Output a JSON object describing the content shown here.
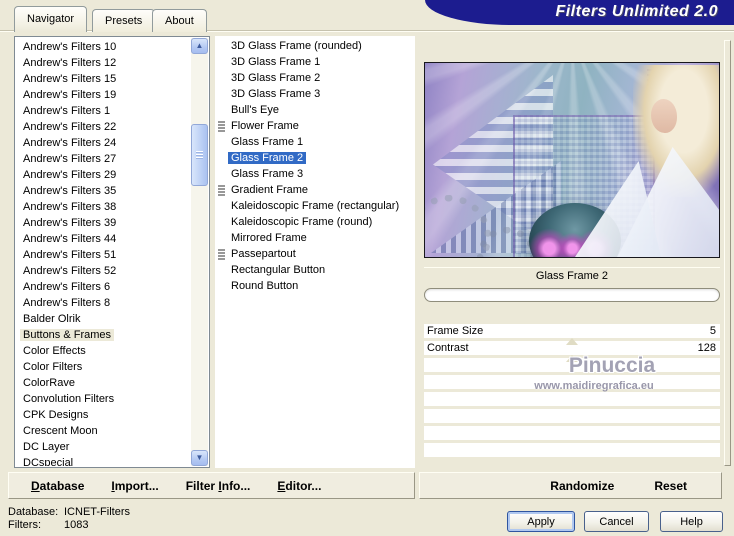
{
  "window": {
    "title": "Filters Unlimited 2.0"
  },
  "tabs": [
    {
      "label": "Navigator",
      "active": true
    },
    {
      "label": "Presets"
    },
    {
      "label": "About"
    }
  ],
  "icons": {
    "scroll_up": "▲",
    "scroll_down": "▼"
  },
  "category_list": {
    "items": [
      {
        "label": "Andrew's Filters 10"
      },
      {
        "label": "Andrew's Filters 12"
      },
      {
        "label": "Andrew's Filters 15"
      },
      {
        "label": "Andrew's Filters 19"
      },
      {
        "label": "Andrew's Filters 1"
      },
      {
        "label": "Andrew's Filters 22"
      },
      {
        "label": "Andrew's Filters 24"
      },
      {
        "label": "Andrew's Filters 27"
      },
      {
        "label": "Andrew's Filters 29"
      },
      {
        "label": "Andrew's Filters 35"
      },
      {
        "label": "Andrew's Filters 38"
      },
      {
        "label": "Andrew's Filters 39"
      },
      {
        "label": "Andrew's Filters 44"
      },
      {
        "label": "Andrew's Filters 51"
      },
      {
        "label": "Andrew's Filters 52"
      },
      {
        "label": "Andrew's Filters 6"
      },
      {
        "label": "Andrew's Filters 8"
      },
      {
        "label": "Balder Olrik"
      },
      {
        "label": "Buttons & Frames",
        "selected": true
      },
      {
        "label": "Color Effects"
      },
      {
        "label": "Color Filters"
      },
      {
        "label": "ColorRave"
      },
      {
        "label": "Convolution Filters"
      },
      {
        "label": "CPK Designs"
      },
      {
        "label": "Crescent Moon"
      },
      {
        "label": "DC Layer"
      },
      {
        "label": "DCspecial"
      }
    ]
  },
  "filter_list": {
    "items": [
      {
        "label": "3D Glass Frame (rounded)"
      },
      {
        "label": "3D Glass Frame 1"
      },
      {
        "label": "3D Glass Frame 2"
      },
      {
        "label": "3D Glass Frame 3"
      },
      {
        "label": "Bull's Eye"
      },
      {
        "label": "Flower Frame",
        "icon": true
      },
      {
        "label": "Glass Frame 1"
      },
      {
        "label": "Glass Frame 2",
        "selected": true
      },
      {
        "label": "Glass Frame 3"
      },
      {
        "label": "Gradient Frame",
        "icon": true
      },
      {
        "label": "Kaleidoscopic Frame (rectangular)"
      },
      {
        "label": "Kaleidoscopic Frame (round)"
      },
      {
        "label": "Mirrored Frame"
      },
      {
        "label": "Passepartout",
        "icon": true
      },
      {
        "label": "Rectangular Button"
      },
      {
        "label": "Round Button"
      }
    ]
  },
  "preview": {
    "selected_filter_label": "Glass Frame 2",
    "watermark_line1": "Pinuccia",
    "watermark_line2": "www.maidiregrafica.eu"
  },
  "controls": {
    "sliders": [
      {
        "label": "Frame Size",
        "value": "5",
        "thumb_pct": 50
      },
      {
        "label": "Contrast",
        "value": "128",
        "thumb_pct": 50
      }
    ],
    "empty_row_count": 6
  },
  "toolbar": {
    "database": {
      "key": "D",
      "rest": "atabase"
    },
    "import": {
      "key": "I",
      "rest": "mport..."
    },
    "filter_info": {
      "pre": "Filter ",
      "key": "I",
      "rest": "nfo..."
    },
    "editor": {
      "key": "E",
      "rest": "ditor..."
    },
    "randomize": "Randomize",
    "reset": "Reset"
  },
  "status": {
    "database_label": "Database:",
    "database_value": "ICNET-Filters",
    "filters_label": "Filters:",
    "filters_value": "1083"
  },
  "buttons": {
    "apply": "Apply",
    "cancel": "Cancel",
    "help": "Help"
  },
  "colors": {
    "bg": "#ece9d8",
    "banner": "#1c1c8f",
    "sel_blue": "#316ac5"
  }
}
